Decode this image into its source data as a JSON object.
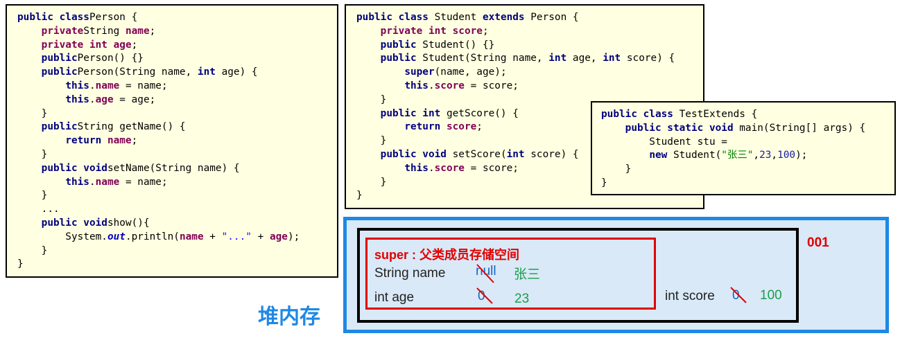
{
  "person_class": {
    "lines": [
      [
        [
          "kwn",
          "public class"
        ],
        [
          "",
          "Person {"
        ]
      ],
      [
        [
          "",
          "    "
        ],
        [
          "kw",
          "private"
        ],
        [
          "",
          "String "
        ],
        [
          "kw",
          "name"
        ],
        [
          "",
          ";"
        ]
      ],
      [
        [
          "",
          "    "
        ],
        [
          "kw",
          "private int"
        ],
        [
          "",
          ""
        ],
        [
          "kw",
          " age"
        ],
        [
          "",
          ";"
        ]
      ],
      [
        [
          "",
          "    "
        ],
        [
          "kwn",
          "public"
        ],
        [
          "",
          "Person() {}"
        ]
      ],
      [
        [
          "",
          "    "
        ],
        [
          "kwn",
          "public"
        ],
        [
          "",
          "Person(String name, "
        ],
        [
          "kwn",
          "int"
        ],
        [
          "",
          " age) {"
        ]
      ],
      [
        [
          "",
          "        "
        ],
        [
          "kwn",
          "this"
        ],
        [
          "",
          "."
        ],
        [
          "kw",
          "name"
        ],
        [
          "",
          " = name;"
        ]
      ],
      [
        [
          "",
          "        "
        ],
        [
          "kwn",
          "this"
        ],
        [
          "",
          "."
        ],
        [
          "kw",
          "age"
        ],
        [
          "",
          " = age;"
        ]
      ],
      [
        [
          "",
          "    }"
        ]
      ],
      [
        [
          "",
          "    "
        ],
        [
          "kwn",
          "public"
        ],
        [
          "",
          "String getName() {"
        ]
      ],
      [
        [
          "",
          "        "
        ],
        [
          "kwn",
          "return"
        ],
        [
          "",
          ""
        ],
        [
          "kw",
          " name"
        ],
        [
          "",
          ";"
        ]
      ],
      [
        [
          "",
          "    }"
        ]
      ],
      [
        [
          "",
          "    "
        ],
        [
          "kwn",
          "public void"
        ],
        [
          "",
          "setName(String name) {"
        ]
      ],
      [
        [
          "",
          "        "
        ],
        [
          "kwn",
          "this"
        ],
        [
          "",
          "."
        ],
        [
          "kw",
          "name"
        ],
        [
          "",
          " = name;"
        ]
      ],
      [
        [
          "",
          "    }"
        ]
      ],
      [
        [
          "",
          "    ..."
        ]
      ],
      [
        [
          "",
          "    "
        ],
        [
          "kwn",
          "public void"
        ],
        [
          "",
          "show(){"
        ]
      ],
      [
        [
          "",
          "        System."
        ],
        [
          "ital",
          "out"
        ],
        [
          "",
          ".println("
        ],
        [
          "kw",
          "name"
        ],
        [
          "",
          " + "
        ],
        [
          "str",
          "\"...\""
        ],
        [
          "",
          " + "
        ],
        [
          "kw",
          "age"
        ],
        [
          "",
          ");"
        ]
      ],
      [
        [
          "",
          "    }"
        ]
      ],
      [
        [
          "",
          "}"
        ]
      ]
    ]
  },
  "student_class": {
    "lines": [
      [
        [
          "kwn",
          "public class"
        ],
        [
          "",
          " Student "
        ],
        [
          "kwn",
          "extends"
        ],
        [
          "",
          " Person {"
        ]
      ],
      [
        [
          "",
          "    "
        ],
        [
          "kw",
          "private int"
        ],
        [
          "",
          ""
        ],
        [
          "kw",
          " score"
        ],
        [
          "",
          ";"
        ]
      ],
      [
        [
          "",
          "    "
        ],
        [
          "kwn",
          "public"
        ],
        [
          "",
          " Student() {}"
        ]
      ],
      [
        [
          "",
          "    "
        ],
        [
          "kwn",
          "public"
        ],
        [
          "",
          " Student(String name, "
        ],
        [
          "kwn",
          "int"
        ],
        [
          "",
          " age, "
        ],
        [
          "kwn",
          "int"
        ],
        [
          "",
          " score) {"
        ]
      ],
      [
        [
          "",
          "        "
        ],
        [
          "kwn",
          "super"
        ],
        [
          "",
          "(name, age);"
        ]
      ],
      [
        [
          "",
          "        "
        ],
        [
          "kwn",
          "this"
        ],
        [
          "",
          "."
        ],
        [
          "kw",
          "score"
        ],
        [
          "",
          " = score;"
        ]
      ],
      [
        [
          "",
          "    }"
        ]
      ],
      [
        [
          "",
          "    "
        ],
        [
          "kwn",
          "public int"
        ],
        [
          "",
          " getScore() {"
        ]
      ],
      [
        [
          "",
          "        "
        ],
        [
          "kwn",
          "return"
        ],
        [
          "",
          ""
        ],
        [
          "kw",
          " score"
        ],
        [
          "",
          ";"
        ]
      ],
      [
        [
          "",
          "    }"
        ]
      ],
      [
        [
          "",
          "    "
        ],
        [
          "kwn",
          "public void"
        ],
        [
          "",
          " setScore("
        ],
        [
          "kwn",
          "int"
        ],
        [
          "",
          " score) {"
        ]
      ],
      [
        [
          "",
          "        "
        ],
        [
          "kwn",
          "this"
        ],
        [
          "",
          "."
        ],
        [
          "kw",
          "score"
        ],
        [
          "",
          " = score;"
        ]
      ],
      [
        [
          "",
          "    }"
        ]
      ],
      [
        [
          "",
          "}"
        ]
      ]
    ]
  },
  "test_class": {
    "lines": [
      [
        [
          "kwn",
          "public class"
        ],
        [
          "",
          " TestExtends {"
        ]
      ],
      [
        [
          "",
          "    "
        ],
        [
          "kwn",
          "public static void"
        ],
        [
          "",
          " main(String[] args) {"
        ]
      ],
      [
        [
          "",
          "        Student stu ="
        ]
      ],
      [
        [
          "",
          "        "
        ],
        [
          "kwn",
          "new"
        ],
        [
          "",
          " Student("
        ],
        [
          "strg",
          "\"张三\""
        ],
        [
          "",
          ","
        ],
        [
          "num",
          "23"
        ],
        [
          "",
          ","
        ],
        [
          "num",
          "100"
        ],
        [
          "",
          ");"
        ]
      ],
      [
        [
          "",
          "    }"
        ]
      ],
      [
        [
          "",
          "}"
        ]
      ]
    ]
  },
  "heap": {
    "label": "堆内存",
    "address": "001",
    "super_title": "super : 父类成员存储空间",
    "name_field": "String name",
    "name_old": "null",
    "name_new": "张三",
    "age_field": "int age",
    "age_old": "0",
    "age_new": "23",
    "score_field": "int score",
    "score_old": "0",
    "score_new": "100"
  },
  "colors": {
    "accent": "#1e88e5",
    "super_border": "#e00000",
    "code_bg": "#ffffe1",
    "panel_bg": "#d9e9f7"
  }
}
